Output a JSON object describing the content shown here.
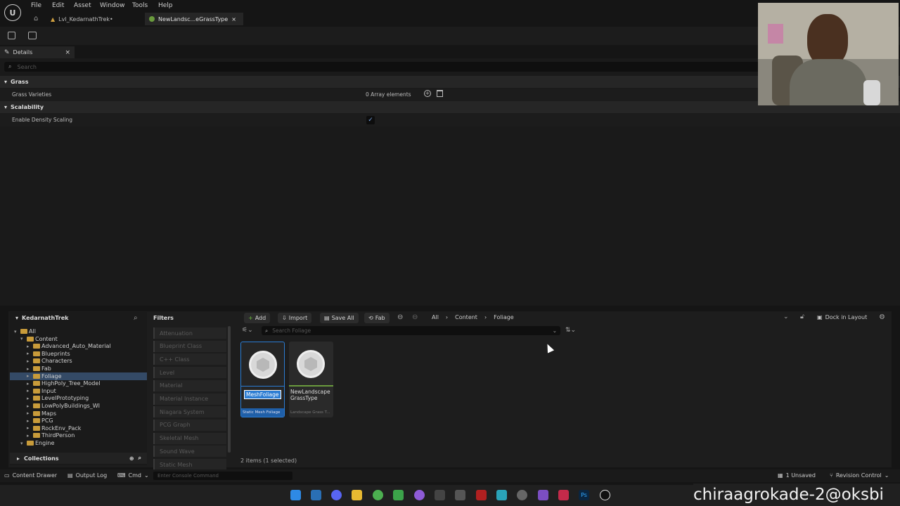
{
  "menu": [
    "File",
    "Edit",
    "Asset",
    "Window",
    "Tools",
    "Help"
  ],
  "tabs": [
    {
      "label": "Lvl_KedarnathTrek•"
    },
    {
      "label": "NewLandsc...eGrassType",
      "close": "×"
    }
  ],
  "details": {
    "tab_label": "Details",
    "close": "×",
    "search_placeholder": "Search",
    "categories": [
      {
        "name": "Grass",
        "props": [
          {
            "label": "Grass Varieties",
            "value": "0 Array elements"
          }
        ]
      },
      {
        "name": "Scalability",
        "props": [
          {
            "label": "Enable Density Scaling",
            "checked": true
          }
        ]
      }
    ]
  },
  "content_browser": {
    "root": "KedarnathTrek",
    "filters_label": "Filters",
    "tree": [
      {
        "label": "All",
        "depth": 0
      },
      {
        "label": "Content",
        "depth": 1
      },
      {
        "label": "Advanced_Auto_Material",
        "depth": 2
      },
      {
        "label": "Blueprints",
        "depth": 2
      },
      {
        "label": "Characters",
        "depth": 2
      },
      {
        "label": "Fab",
        "depth": 2
      },
      {
        "label": "Foliage",
        "depth": 2,
        "selected": true
      },
      {
        "label": "HighPoly_Tree_Model",
        "depth": 2
      },
      {
        "label": "Input",
        "depth": 2
      },
      {
        "label": "LevelPrototyping",
        "depth": 2
      },
      {
        "label": "LowPolyBuildings_WI",
        "depth": 2
      },
      {
        "label": "Maps",
        "depth": 2
      },
      {
        "label": "PCG",
        "depth": 2
      },
      {
        "label": "RockEnv_Pack",
        "depth": 2
      },
      {
        "label": "ThirdPerson",
        "depth": 2
      },
      {
        "label": "Engine",
        "depth": 1
      }
    ],
    "collections_label": "Collections",
    "filters": [
      "Attenuation",
      "Blueprint Class",
      "C++ Class",
      "Level",
      "Material",
      "Material Instance",
      "Niagara System",
      "PCG Graph",
      "Skeletal Mesh",
      "Sound Wave",
      "Static Mesh"
    ],
    "toolbar": {
      "add": "Add",
      "import": "Import",
      "save_all": "Save All",
      "fab": "Fab"
    },
    "breadcrumb": [
      "All",
      "Content",
      "Foliage"
    ],
    "dock_label": "Dock in Layout",
    "search_placeholder": "Search Foliage",
    "assets": [
      {
        "name": "MeshFoliage",
        "type": "Static Mesh Foliage",
        "selected": true,
        "color": "#2b7cd3"
      },
      {
        "name": "NewLandscape GrassType",
        "type": "Landscape Grass T...",
        "selected": false,
        "color": "#6a9b3d"
      }
    ],
    "status": "2 items (1 selected)"
  },
  "bottom_bar": {
    "content_drawer": "Content Drawer",
    "output_log": "Output Log",
    "cmd": "Cmd",
    "console_placeholder": "Enter Console Command",
    "unsaved": "1 Unsaved",
    "revision": "Revision Control"
  },
  "watermark": "chiraagrokade-2@oksbi"
}
